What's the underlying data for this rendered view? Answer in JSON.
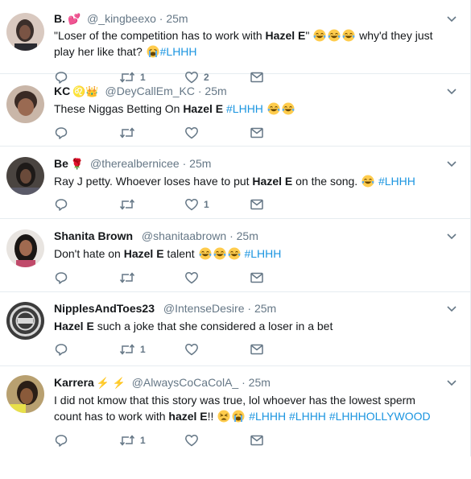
{
  "tweets": [
    {
      "name": "B.",
      "badge": "💕",
      "handle": "@_kingbeexo",
      "time": "25m",
      "text_parts": [
        {
          "t": "\"Loser of the competition has to work with "
        },
        {
          "t": "Hazel E",
          "b": true
        },
        {
          "t": "\" "
        },
        {
          "e": "laugh"
        },
        {
          "e": "laugh"
        },
        {
          "e": "laugh"
        },
        {
          "t": " why'd they just play her like that? "
        },
        {
          "e": "cry"
        },
        {
          "t": "#LHHH",
          "h": true
        }
      ],
      "replies": "",
      "retweets": "1",
      "likes": "2",
      "avatar_color": "#3a2e2a"
    },
    {
      "name": "KC",
      "badge": "♌👑",
      "handle": "@DeyCallEm_KC",
      "time": "25m",
      "text_parts": [
        {
          "t": "These Niggas Betting On "
        },
        {
          "t": "Hazel E",
          "b": true
        },
        {
          "t": " "
        },
        {
          "t": "#LHHH",
          "h": true
        },
        {
          "t": " "
        },
        {
          "e": "laugh"
        },
        {
          "e": "laugh"
        }
      ],
      "replies": "",
      "retweets": "",
      "likes": "",
      "avatar_color": "#5a3b30"
    },
    {
      "name": "Be",
      "badge": "🌹",
      "handle": "@therealbernicee",
      "time": "25m",
      "text_parts": [
        {
          "t": "Ray J petty. Whoever loses have to put "
        },
        {
          "t": "Hazel E",
          "b": true
        },
        {
          "t": " on the song. "
        },
        {
          "e": "laugh"
        },
        {
          "t": " "
        },
        {
          "t": "#LHHH",
          "h": true
        }
      ],
      "replies": "",
      "retweets": "",
      "likes": "1",
      "avatar_color": "#2b2420"
    },
    {
      "name": "Shanita Brown",
      "badge": "",
      "handle": "@shanitaabrown",
      "time": "25m",
      "text_parts": [
        {
          "t": "Don't hate on "
        },
        {
          "t": "Hazel E",
          "b": true
        },
        {
          "t": " talent "
        },
        {
          "e": "laugh"
        },
        {
          "e": "laugh"
        },
        {
          "e": "laugh"
        },
        {
          "t": " "
        },
        {
          "t": "#LHHH",
          "h": true
        }
      ],
      "replies": "",
      "retweets": "",
      "likes": "",
      "avatar_color": "#6b4a3a"
    },
    {
      "name": "NipplesAndToes23",
      "badge": "",
      "handle": "@IntenseDesire",
      "time": "25m",
      "text_parts": [
        {
          "t": "Hazel E",
          "b": true
        },
        {
          "t": " such a joke that she considered a loser in a bet"
        }
      ],
      "replies": "",
      "retweets": "1",
      "likes": "",
      "avatar_color": "#3b3b3b"
    },
    {
      "name": "Karrera",
      "badge": "⚡ ⚡",
      "handle": "@AlwaysCoCaColA_",
      "time": "25m",
      "text_parts": [
        {
          "t": "I did not kmow that this story was true, lol whoever has the lowest sperm count has to work with "
        },
        {
          "t": "hazel E",
          "b": true
        },
        {
          "t": "!! "
        },
        {
          "e": "weary"
        },
        {
          "e": "cry"
        },
        {
          "t": " "
        },
        {
          "t": "#LHHH",
          "h": true
        },
        {
          "t": " "
        },
        {
          "t": "#LHHH",
          "h": true
        },
        {
          "t": " "
        },
        {
          "t": "#LHHHOLLYWOOD",
          "h": true
        }
      ],
      "replies": "",
      "retweets": "1",
      "likes": "",
      "avatar_color": "#8a6a40"
    }
  ],
  "colors": {
    "icon": "#657786",
    "hashtag": "#1b95e0",
    "border": "#e6ecf0"
  }
}
